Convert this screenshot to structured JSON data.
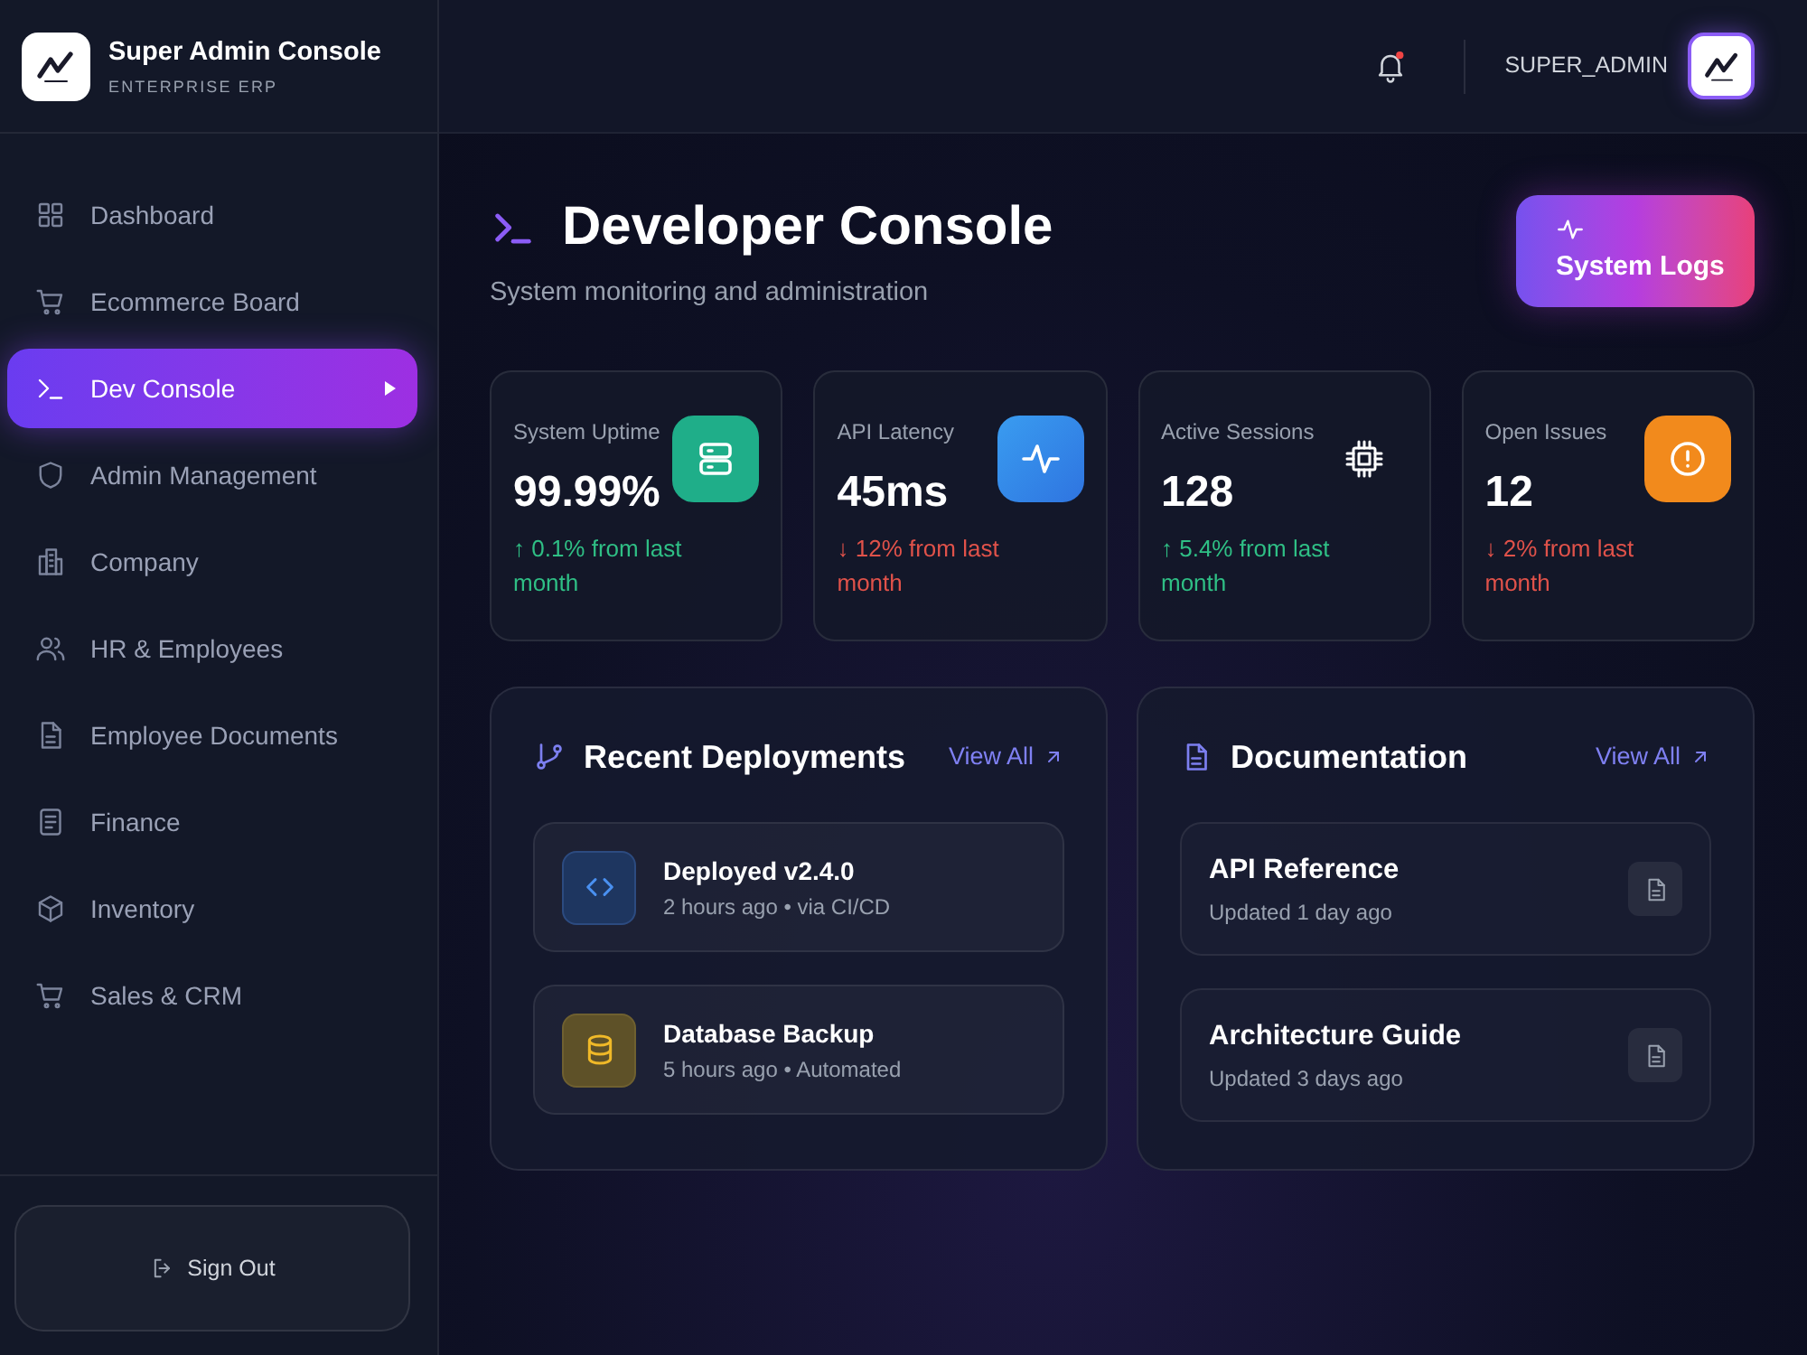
{
  "sidebar": {
    "brand": {
      "title": "Super Admin Console",
      "subtitle": "ENTERPRISE ERP"
    },
    "items": [
      {
        "label": "Dashboard",
        "selected": false
      },
      {
        "label": "Ecommerce Board",
        "selected": false
      },
      {
        "label": "Dev Console",
        "selected": true
      },
      {
        "label": "Admin Management",
        "selected": false
      },
      {
        "label": "Company",
        "selected": false
      },
      {
        "label": "HR & Employees",
        "selected": false
      },
      {
        "label": "Employee Documents",
        "selected": false
      },
      {
        "label": "Finance",
        "selected": false
      },
      {
        "label": "Inventory",
        "selected": false
      },
      {
        "label": "Sales & CRM",
        "selected": false
      }
    ],
    "sign_out": "Sign Out"
  },
  "top_bar": {
    "notifications": {
      "unread": true
    },
    "user": "SUPER_ADMIN"
  },
  "page": {
    "title": "Developer Console",
    "subtitle": "System monitoring and administration",
    "action": "System Logs"
  },
  "stats": [
    {
      "label": "System Uptime",
      "value": "99.99%",
      "change": "↑ 0.1% from last month",
      "rising": true
    },
    {
      "label": "API Latency",
      "value": "45ms",
      "change": "↓ 12% from last month",
      "rising": false
    },
    {
      "label": "Active Sessions",
      "value": "128",
      "change": "↑ 5.4% from last month",
      "rising": true
    },
    {
      "label": "Open Issues",
      "value": "12",
      "change": "↓ 2% from last month",
      "rising": false
    }
  ],
  "deployments": {
    "title": "Recent Deployments",
    "link": "View All",
    "items": [
      {
        "title": "Deployed v2.4.0",
        "meta": "2 hours ago • via CI/CD"
      },
      {
        "title": "Database Backup",
        "meta": "5 hours ago • Automated"
      }
    ]
  },
  "documentation": {
    "title": "Documentation",
    "link": "View All",
    "items": [
      {
        "title": "API Reference",
        "meta": "Updated 1 day ago"
      },
      {
        "title": "Architecture Guide",
        "meta": "Updated 3 days ago"
      }
    ]
  }
}
